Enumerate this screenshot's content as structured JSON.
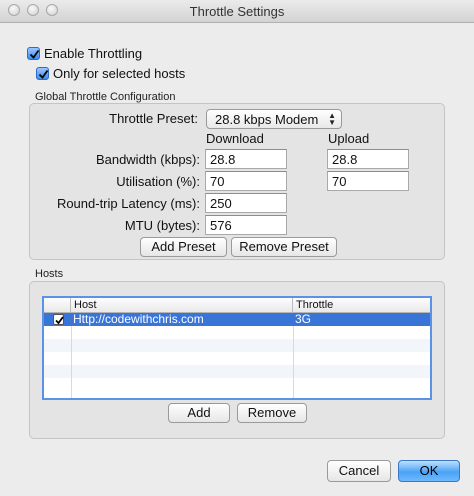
{
  "window": {
    "title": "Throttle Settings"
  },
  "options": {
    "enable_throttling": {
      "label": "Enable Throttling",
      "checked": true
    },
    "only_selected_hosts": {
      "label": "Only for selected hosts",
      "checked": true
    }
  },
  "global": {
    "group_label": "Global Throttle Configuration",
    "preset_label": "Throttle Preset:",
    "preset_value": "28.8 kbps Modem",
    "col_download": "Download",
    "col_upload": "Upload",
    "bandwidth_label": "Bandwidth (kbps):",
    "bandwidth_download": "28.8",
    "bandwidth_upload": "28.8",
    "utilisation_label": "Utilisation (%):",
    "utilisation_download": "70",
    "utilisation_upload": "70",
    "latency_label": "Round-trip Latency (ms):",
    "latency_value": "250",
    "mtu_label": "MTU (bytes):",
    "mtu_value": "576",
    "add_preset": "Add Preset",
    "remove_preset": "Remove Preset"
  },
  "hosts": {
    "group_label": "Hosts",
    "columns": [
      "",
      "Host",
      "Throttle"
    ],
    "rows": [
      {
        "checked": true,
        "host": "Http://codewithchris.com",
        "throttle": "3G",
        "selected": true
      }
    ],
    "add": "Add",
    "remove": "Remove"
  },
  "footer": {
    "cancel": "Cancel",
    "ok": "OK"
  },
  "colors": {
    "selection": "#3875d7",
    "default_button": "#4aa3f7"
  }
}
